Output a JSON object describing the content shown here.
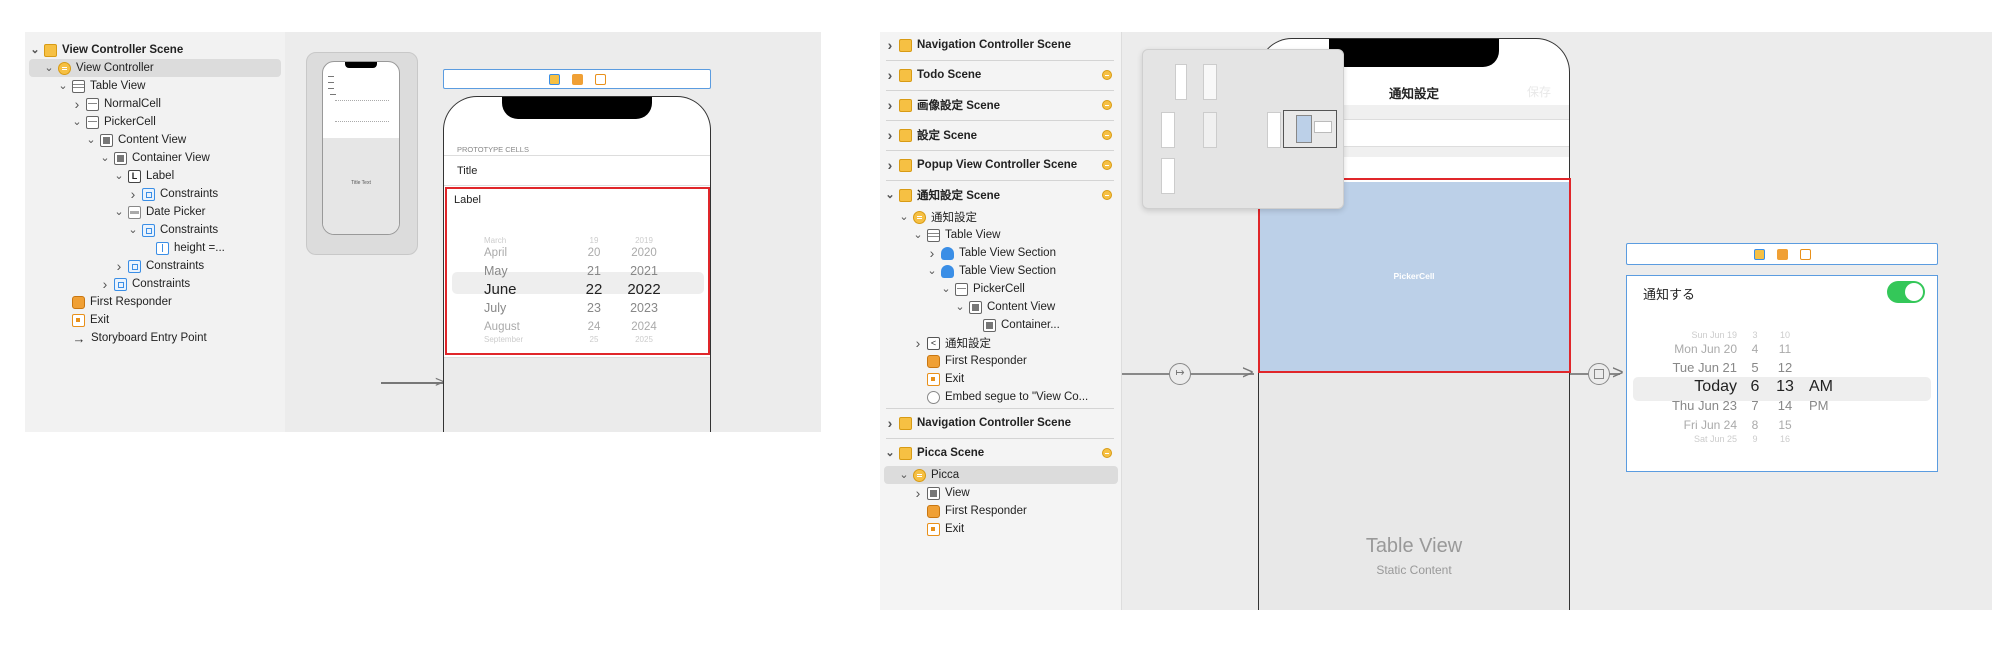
{
  "left": {
    "outline": [
      {
        "label": "View Controller Scene",
        "icon": "scene-icon",
        "chevron": "v",
        "scene": true
      },
      {
        "label": "View Controller",
        "icon": "view-controller-icon",
        "chevron": "v",
        "selected": true
      },
      {
        "label": "Table View",
        "icon": "table-view-icon",
        "chevron": "v"
      },
      {
        "label": "NormalCell",
        "icon": "table-cell-icon",
        "chevron": ">"
      },
      {
        "label": "PickerCell",
        "icon": "table-cell-icon",
        "chevron": "v"
      },
      {
        "label": "Content View",
        "icon": "view-icon",
        "chevron": "v"
      },
      {
        "label": "Container View",
        "icon": "view-icon",
        "chevron": "v"
      },
      {
        "label": "Label",
        "icon": "label-icon",
        "chevron": "v"
      },
      {
        "label": "Constraints",
        "icon": "constraints-icon",
        "chevron": ">"
      },
      {
        "label": "Date Picker",
        "icon": "date-picker-icon",
        "chevron": "v"
      },
      {
        "label": "Constraints",
        "icon": "constraints-icon",
        "chevron": "v"
      },
      {
        "label": "height =...",
        "icon": "height-constraint-icon",
        "chevron": ""
      },
      {
        "label": "Constraints",
        "icon": "constraints-icon",
        "chevron": ">"
      },
      {
        "label": "Constraints",
        "icon": "constraints-icon",
        "chevron": ">"
      },
      {
        "label": "First Responder",
        "icon": "first-responder-icon",
        "chevron": ""
      },
      {
        "label": "Exit",
        "icon": "exit-icon",
        "chevron": ""
      },
      {
        "label": "Storyboard Entry Point",
        "icon": "entry-arrow-icon",
        "chevron": ""
      }
    ],
    "canvas": {
      "prototype_cells": "PROTOTYPE CELLS",
      "title_cell": "Title",
      "label_cell": "Label",
      "picker_rows": [
        {
          "month": "March",
          "day": "19",
          "year": "2019"
        },
        {
          "month": "April",
          "day": "20",
          "year": "2020"
        },
        {
          "month": "May",
          "day": "21",
          "year": "2021"
        },
        {
          "month": "June",
          "day": "22",
          "year": "2022"
        },
        {
          "month": "July",
          "day": "23",
          "year": "2023"
        },
        {
          "month": "August",
          "day": "24",
          "year": "2024"
        },
        {
          "month": "September",
          "day": "25",
          "year": "2025"
        }
      ],
      "thumb_text": "Title Text"
    }
  },
  "right": {
    "outline": [
      {
        "label": "Navigation Controller Scene",
        "icon": "scene-icon",
        "chevron": ">",
        "scene": true,
        "badge": false
      },
      {
        "label": "Todo Scene",
        "icon": "scene-icon",
        "chevron": ">",
        "scene": true,
        "badge": true
      },
      {
        "label": "画像設定 Scene",
        "icon": "scene-icon",
        "chevron": ">",
        "scene": true,
        "badge": true
      },
      {
        "label": "設定 Scene",
        "icon": "scene-icon",
        "chevron": ">",
        "scene": true,
        "badge": true
      },
      {
        "label": "Popup View Controller Scene",
        "icon": "scene-icon",
        "chevron": ">",
        "scene": true,
        "badge": true
      },
      {
        "label": "通知設定 Scene",
        "icon": "scene-icon",
        "chevron": "v",
        "scene": true,
        "badge": true
      },
      {
        "label": "通知設定",
        "icon": "view-controller-icon",
        "chevron": "v"
      },
      {
        "label": "Table View",
        "icon": "table-view-icon",
        "chevron": "v"
      },
      {
        "label": "Table View Section",
        "icon": "table-section-icon",
        "chevron": ">"
      },
      {
        "label": "Table View Section",
        "icon": "table-section-icon",
        "chevron": "v"
      },
      {
        "label": "PickerCell",
        "icon": "table-cell-icon",
        "chevron": "v"
      },
      {
        "label": "Content View",
        "icon": "view-icon",
        "chevron": "v"
      },
      {
        "label": "Container...",
        "icon": "view-icon",
        "chevron": ""
      },
      {
        "label": "通知設定",
        "icon": "back-item-icon",
        "chevron": ">"
      },
      {
        "label": "First Responder",
        "icon": "first-responder-icon",
        "chevron": ""
      },
      {
        "label": "Exit",
        "icon": "exit-icon",
        "chevron": ""
      },
      {
        "label": "Embed segue to \"View Co...",
        "icon": "segue-icon",
        "chevron": ""
      },
      {
        "label": "Navigation Controller Scene",
        "icon": "scene-icon",
        "chevron": ">",
        "scene": true,
        "badge": false
      },
      {
        "label": "Picca Scene",
        "icon": "scene-icon",
        "chevron": "v",
        "scene": true,
        "badge": true
      },
      {
        "label": "Picca",
        "icon": "view-controller-icon",
        "chevron": "v",
        "selected": true
      },
      {
        "label": "View",
        "icon": "view-icon",
        "chevron": ">"
      },
      {
        "label": "First Responder",
        "icon": "first-responder-icon",
        "chevron": ""
      },
      {
        "label": "Exit",
        "icon": "exit-icon",
        "chevron": ""
      }
    ],
    "canvas": {
      "nav_title": "通知設定",
      "nav_right": "保存",
      "picker_cell": "PickerCell",
      "table_view_title": "Table View",
      "table_view_sub": "Static Content",
      "toggle_label": "通知する",
      "date_rows": [
        {
          "date": "Sun Jun 19",
          "hour": "3",
          "minute": "10",
          "ampm": ""
        },
        {
          "date": "Mon Jun 20",
          "hour": "4",
          "minute": "11",
          "ampm": ""
        },
        {
          "date": "Tue Jun 21",
          "hour": "5",
          "minute": "12",
          "ampm": ""
        },
        {
          "date": "Today",
          "hour": "6",
          "minute": "13",
          "ampm": "AM"
        },
        {
          "date": "Thu Jun 23",
          "hour": "7",
          "minute": "14",
          "ampm": "PM"
        },
        {
          "date": "Fri Jun 24",
          "hour": "8",
          "minute": "15",
          "ampm": ""
        },
        {
          "date": "Sat Jun 25",
          "hour": "9",
          "minute": "16",
          "ampm": ""
        }
      ]
    }
  }
}
